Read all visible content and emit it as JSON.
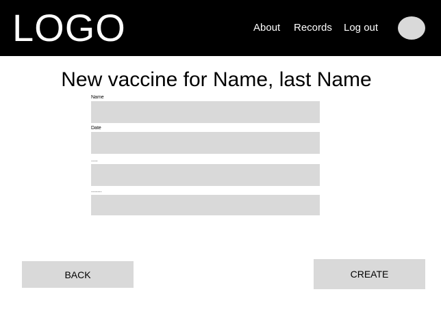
{
  "header": {
    "logo": "LOGO",
    "nav": {
      "about": "About",
      "records": "Records",
      "logout": "Log out"
    }
  },
  "page": {
    "title": "New vaccine for Name, last Name"
  },
  "form": {
    "fields": [
      {
        "label": "Name",
        "value": ""
      },
      {
        "label": "Date",
        "value": ""
      },
      {
        "label": ".....",
        "value": ""
      },
      {
        "label": "........",
        "value": ""
      }
    ]
  },
  "buttons": {
    "back": "BACK",
    "create": "CREATE"
  },
  "colors": {
    "header_bg": "#000000",
    "field_bg": "#d9d9d9",
    "button_bg": "#d9d9d9",
    "avatar": "#d9d9d9"
  }
}
